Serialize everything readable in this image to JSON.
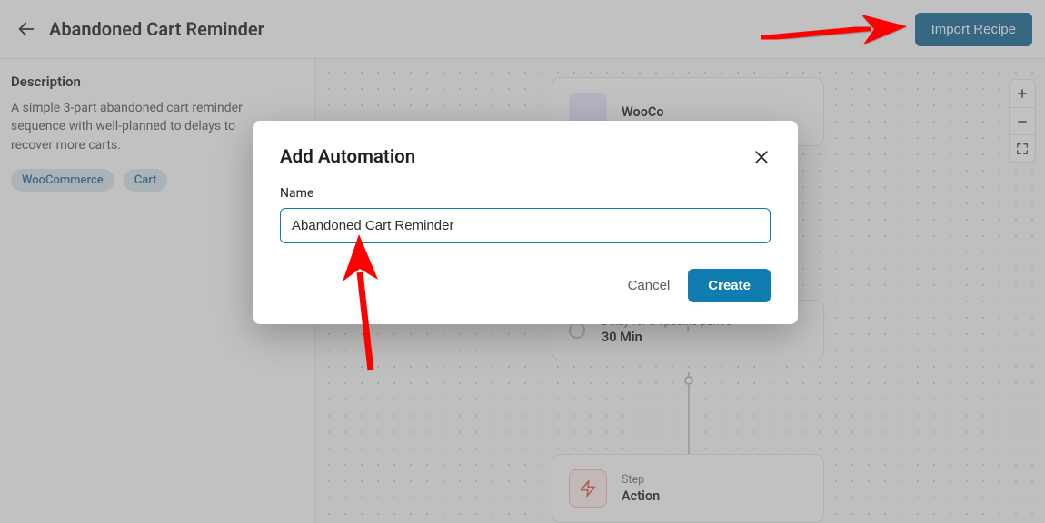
{
  "header": {
    "title": "Abandoned Cart Reminder",
    "import_label": "Import Recipe"
  },
  "sidebar": {
    "description_heading": "Description",
    "description_text": "A simple 3-part abandoned cart reminder sequence with well-planned to delays to recover more carts.",
    "tags": [
      "WooCommerce",
      "Cart"
    ]
  },
  "canvas": {
    "node_trigger": {
      "label": "WooCo"
    },
    "node_delay": {
      "subtitle": "Delay for a specific period",
      "value": "30 Min"
    },
    "node_action": {
      "subtitle": "Step",
      "title": "Action"
    }
  },
  "modal": {
    "title": "Add Automation",
    "name_label": "Name",
    "name_value": "Abandoned Cart Reminder",
    "cancel_label": "Cancel",
    "create_label": "Create"
  },
  "colors": {
    "primary": "#0f7db0",
    "header_button": "#005b8f",
    "arrow": "#ff0000"
  }
}
